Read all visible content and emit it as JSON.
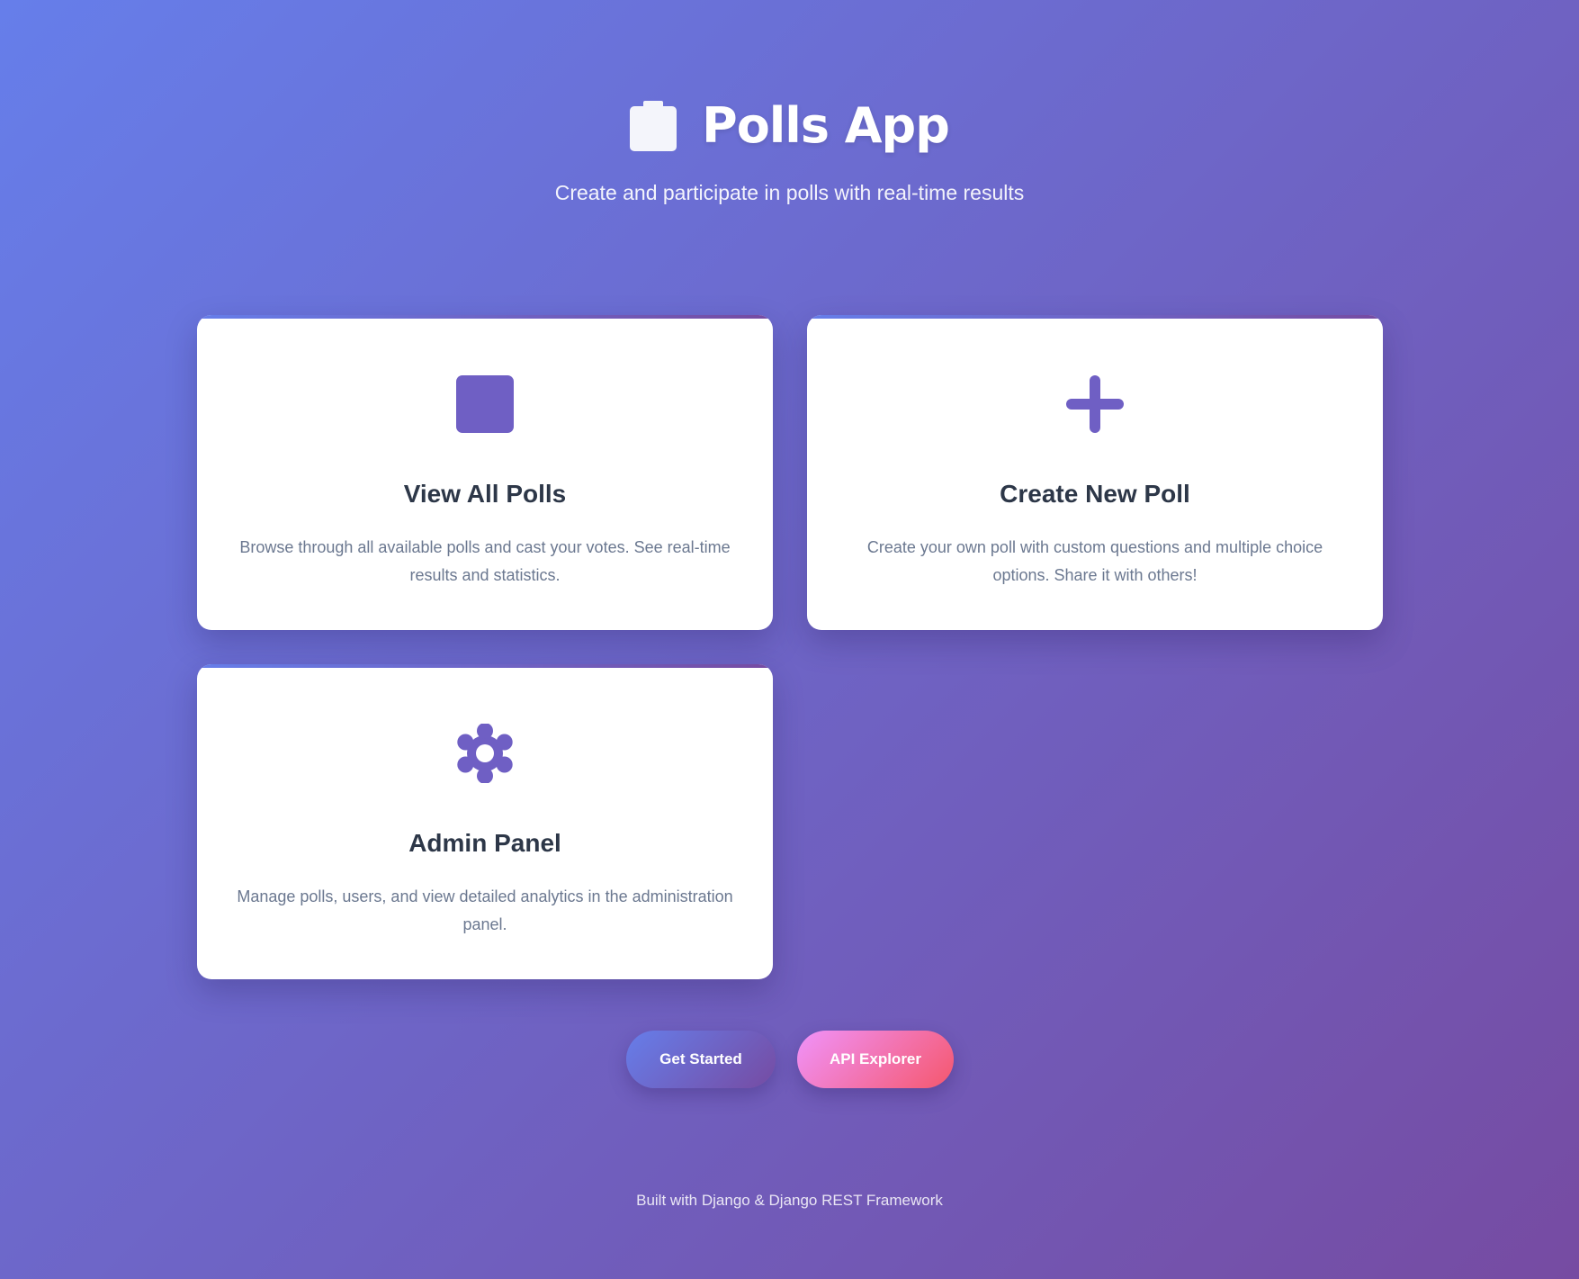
{
  "header": {
    "title": "Polls App",
    "subtitle": "Create and participate in polls with real-time results",
    "icon": "clipboard-icon"
  },
  "cards": [
    {
      "icon": "square-icon",
      "title": "View All Polls",
      "description": "Browse through all available polls and cast your votes. See real-time results and statistics."
    },
    {
      "icon": "plus-icon",
      "title": "Create New Poll",
      "description": "Create your own poll with custom questions and multiple choice options. Share it with others!"
    },
    {
      "icon": "gear-icon",
      "title": "Admin Panel",
      "description": "Manage polls, users, and view detailed analytics in the administration panel."
    }
  ],
  "actions": {
    "primary_label": "Get Started",
    "secondary_label": "API Explorer"
  },
  "footer": {
    "text": "Built with Django & Django REST Framework"
  },
  "colors": {
    "background_start": "#667eea",
    "background_end": "#764ba2",
    "accent": "#6f5fc4",
    "secondary_start": "#f093fb",
    "secondary_end": "#f5576c"
  }
}
